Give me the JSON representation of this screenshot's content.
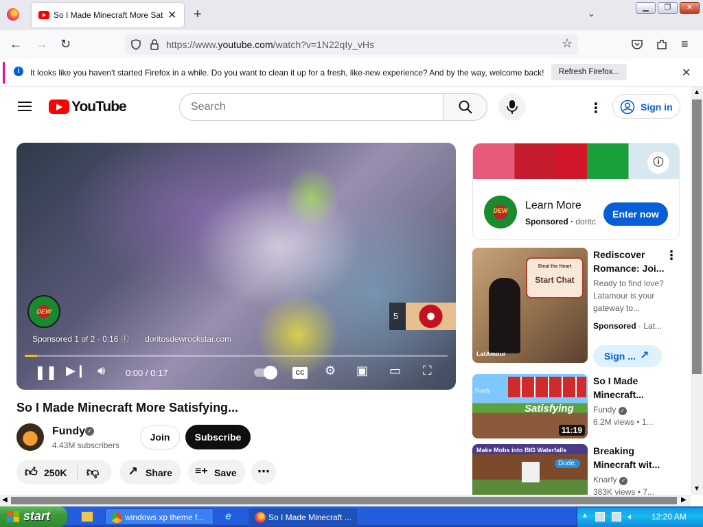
{
  "browser": {
    "tab_title": "So I Made Minecraft More Satisfying...",
    "url_prefix": "https://www.",
    "url_domain": "youtube.com",
    "url_path": "/watch?v=1N22qIy_vHs"
  },
  "notice": {
    "text": "It looks like you haven't started Firefox in a while. Do you want to clean it up for a fresh, like-new experience? And by the way, welcome back!",
    "button": "Refresh Firefox..."
  },
  "yt": {
    "logo": "YouTube",
    "search_placeholder": "Search",
    "signin": "Sign in"
  },
  "player": {
    "ad_label": "Sponsored 1 of 2 · 0:16",
    "ad_link": "doritosdewrockstar.com",
    "skip_count": "5",
    "time": "0:00 / 0:17",
    "progress": 0.03,
    "brand": "DEW"
  },
  "video": {
    "title": "So I Made Minecraft More Satisfying...",
    "channel": "Fundy",
    "subs": "4.43M subscribers",
    "join": "Join",
    "subscribe": "Subscribe",
    "likes": "250K",
    "share": "Share",
    "save": "Save"
  },
  "ad_card": {
    "title": "Learn More",
    "sponsored": "Sponsored",
    "domain": "doritc",
    "cta": "Enter now"
  },
  "recs": [
    {
      "title": "Rediscover Romance: Joi...",
      "desc": "Ready to find love? Latamour is your gateway to...",
      "meta": "Sponsored",
      "meta2": "Lat...",
      "cta": "Sign ...",
      "thumb_text": "Start Chat",
      "thumb_sub": "Steal the Heart",
      "thumb_brand": "LatAmour"
    },
    {
      "title": "So I Made Minecraft...",
      "channel": "Fundy",
      "meta": "6.2M views • 1...",
      "duration": "11:19",
      "thumb_text": "Satisfying",
      "thumb_brand": "Fundy"
    },
    {
      "title": "Breaking Minecraft wit...",
      "channel": "Knarfy",
      "meta": "383K views • 7...",
      "thumb_text": "Make Mobs into BIG Waterfalls",
      "thumb_badge": "Dude."
    }
  ],
  "taskbar": {
    "start": "start",
    "items": [
      "windows xp theme f...",
      "So I Made Minecraft ..."
    ],
    "clock": "12:20 AM"
  },
  "colors": {
    "yt_red": "#ff0000",
    "link_blue": "#065fd4",
    "xp_blue": "#245edc"
  }
}
